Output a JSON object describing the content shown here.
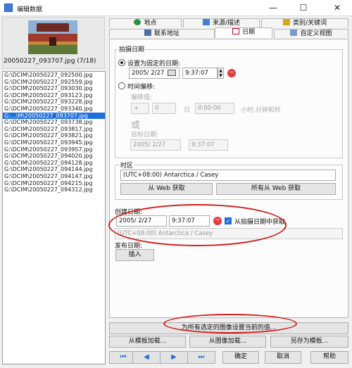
{
  "window": {
    "title": "编辑数据",
    "minimize": "—",
    "maximize": "☐",
    "close": "✕"
  },
  "left": {
    "caption": "20050227_093707.jpg (7/18)",
    "files": [
      "G:\\DCIM\\20050227_092500.jpg",
      "G:\\DCIM\\20050227_092559.jpg",
      "G:\\DCIM\\20050227_093030.jpg",
      "G:\\DCIM\\20050227_093123.jpg",
      "G:\\DCIM\\20050227_093228.jpg",
      "G:\\DCIM\\20050227_093340.jpg",
      "G:...\\M\\20050227_093707.jpg",
      "G:\\DCIM\\20050227_093738.jpg",
      "G:\\DCIM\\20050227_093817.jpg",
      "G:\\DCIM\\20050227_093821.jpg",
      "G:\\DCIM\\20050227_093945.jpg",
      "G:\\DCIM\\20050227_093957.jpg",
      "G:\\DCIM\\20050227_094020.jpg",
      "G:\\DCIM\\20050227_094128.jpg",
      "G:\\DCIM\\20050227_094144.jpg",
      "G:\\DCIM\\20050227_094147.jpg",
      "G:\\DCIM\\20050227_094215.jpg",
      "G:\\DCIM\\20050227_094312.jpg"
    ],
    "selected_index": 6
  },
  "tabs": {
    "location": "地点",
    "source": "来源/描述",
    "category": "类别/关键词",
    "contact": "联系地址",
    "date": "日期",
    "custom": "自定义视图"
  },
  "capture": {
    "group_label": "拍摄日期",
    "fixed_label": "设置为固定的日期:",
    "fixed_date": "2005/ 2/27",
    "fixed_time": "9:37:07",
    "offset_label": "时间偏移:",
    "offset_value_label": "偏移值:",
    "offset_sign": "+",
    "offset_days": "0",
    "days_unit": "日",
    "offset_time": "0:00:00",
    "offset_units": "小时,分钟和秒",
    "or_label": "或",
    "target_label": "目标日期:",
    "target_date": "2005/ 2/27",
    "target_time": "9:37:07"
  },
  "timezone": {
    "group_label": "时区",
    "value": "(UTC+08:00) Antarctica / Casey",
    "web_fetch": "从 Web 获取",
    "web_fetch_all": "所有从 Web 获取"
  },
  "creation": {
    "label": "创建日期:",
    "date": "2005/  2/27",
    "time": "9:37:07",
    "from_capture": "从拍摄日期中获取",
    "timezone": "(UTC+08:00) Antarctica / Casey"
  },
  "publish": {
    "label": "发布日期:",
    "insert": "插入"
  },
  "bottom": {
    "apply_all": "为所有选定的图像设置当前的值...",
    "load_template": "从模板加载...",
    "load_image": "从图像加载...",
    "save_template": "另存为模板...",
    "first": "⏮",
    "prev": "◀",
    "next": "▶",
    "last": "⏭",
    "ok": "确定",
    "cancel": "取消",
    "help": "帮助"
  },
  "colors": {
    "selection": "#1e6fd9",
    "annotation": "#d21d1d",
    "remove": "#e23b3b"
  }
}
